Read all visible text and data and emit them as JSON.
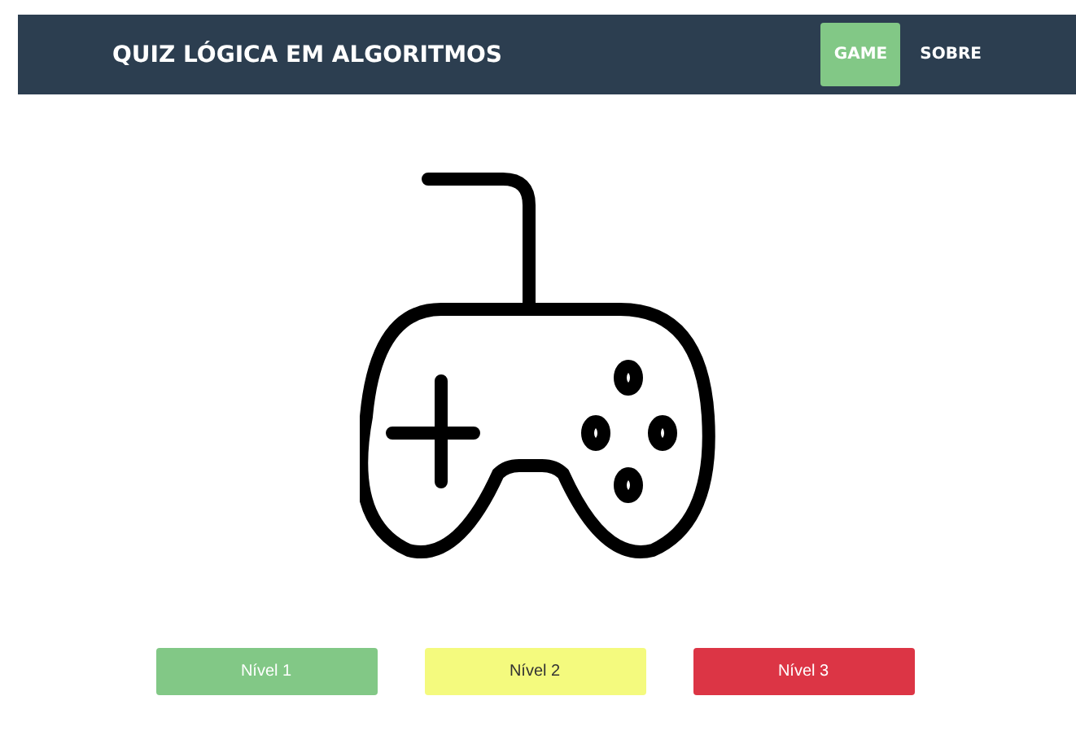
{
  "navbar": {
    "title": "QUIZ LÓGICA EM ALGORITMOS",
    "links": [
      {
        "label": "GAME",
        "selected": true
      },
      {
        "label": "SOBRE",
        "selected": false
      }
    ]
  },
  "levels": [
    {
      "label": "Nível 1",
      "color": "#82c886"
    },
    {
      "label": "Nível 2",
      "color": "#f4fa7e"
    },
    {
      "label": "Nível 3",
      "color": "#dc3545"
    }
  ]
}
